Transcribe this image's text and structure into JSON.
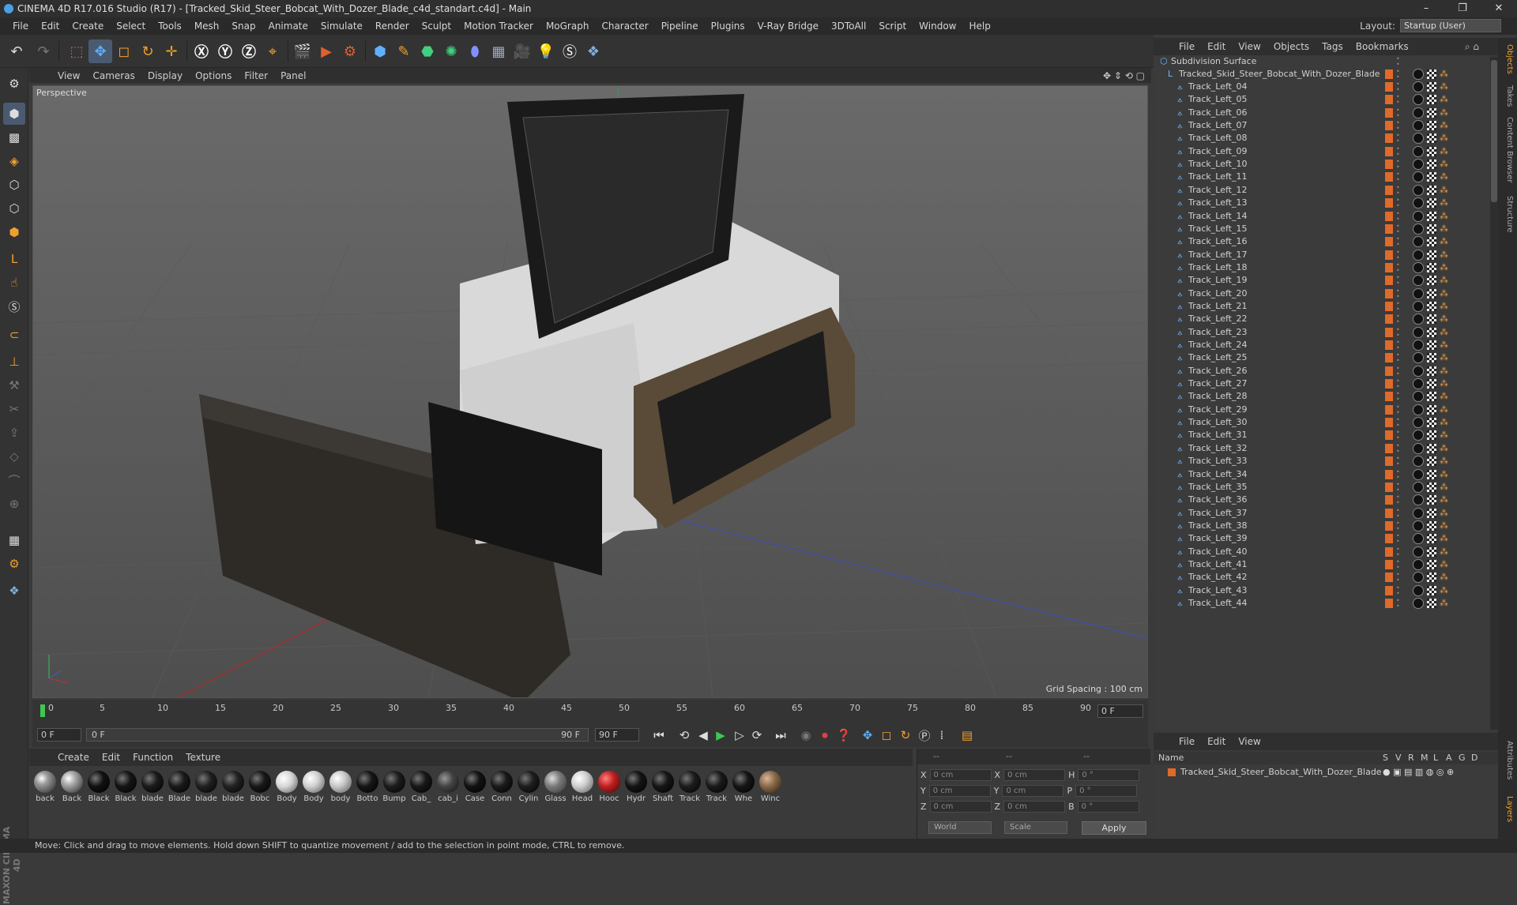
{
  "title": "CINEMA 4D R17.016 Studio (R17) - [Tracked_Skid_Steer_Bobcat_With_Dozer_Blade_c4d_standart.c4d] - Main",
  "window_controls": [
    "–",
    "❐",
    "✕"
  ],
  "menu": [
    "File",
    "Edit",
    "Create",
    "Select",
    "Tools",
    "Mesh",
    "Snap",
    "Animate",
    "Simulate",
    "Render",
    "Sculpt",
    "Motion Tracker",
    "MoGraph",
    "Character",
    "Pipeline",
    "Plugins",
    "V-Ray Bridge",
    "3DToAll",
    "Script",
    "Window",
    "Help"
  ],
  "layout": {
    "label": "Layout:",
    "value": "Startup (User)"
  },
  "viewport": {
    "menu": [
      "View",
      "Cameras",
      "Display",
      "Options",
      "Filter",
      "Panel"
    ],
    "label": "Perspective",
    "grid_spacing": "Grid Spacing : 100 cm"
  },
  "timeline": {
    "ticks": [
      "0",
      "5",
      "10",
      "15",
      "20",
      "25",
      "30",
      "35",
      "40",
      "45",
      "50",
      "55",
      "60",
      "65",
      "70",
      "75",
      "80",
      "85",
      "90"
    ],
    "end_field": "0 F"
  },
  "transport": {
    "current": "0 F",
    "range_start": "0 F",
    "range_end": "90 F",
    "max": "90 F"
  },
  "materials": {
    "menu": [
      "Create",
      "Edit",
      "Function",
      "Texture"
    ],
    "items": [
      {
        "label": "back",
        "color": "#9a9a9a"
      },
      {
        "label": "Back",
        "color": "#b0b0b0"
      },
      {
        "label": "Black",
        "color": "#111111"
      },
      {
        "label": "Black",
        "color": "#151515"
      },
      {
        "label": "blade",
        "color": "#1a1a1a"
      },
      {
        "label": "Blade",
        "color": "#1a1a1a"
      },
      {
        "label": "blade",
        "color": "#202020"
      },
      {
        "label": "blade",
        "color": "#222222"
      },
      {
        "label": "Bobc",
        "color": "#181818"
      },
      {
        "label": "Body",
        "color": "#d8d8d8"
      },
      {
        "label": "Body",
        "color": "#d0d0d0"
      },
      {
        "label": "body",
        "color": "#c8c8c8"
      },
      {
        "label": "Botto",
        "color": "#161616"
      },
      {
        "label": "Bump",
        "color": "#1c1c1c"
      },
      {
        "label": "Cab_",
        "color": "#181818"
      },
      {
        "label": "cab_i",
        "color": "#444444"
      },
      {
        "label": "Case",
        "color": "#121212"
      },
      {
        "label": "Conn",
        "color": "#1a1a1a"
      },
      {
        "label": "Cylin",
        "color": "#1e1e1e"
      },
      {
        "label": "Glass",
        "color": "#7a7a7a"
      },
      {
        "label": "Head",
        "color": "#cfcfcf"
      },
      {
        "label": "Hooc",
        "color": "#c02020"
      },
      {
        "label": "Hydr",
        "color": "#141414"
      },
      {
        "label": "Shaft",
        "color": "#161616"
      },
      {
        "label": "Track",
        "color": "#1c1c1c"
      },
      {
        "label": "Track",
        "color": "#1a1a1a"
      },
      {
        "label": "Whe",
        "color": "#151515"
      },
      {
        "label": "Winc",
        "color": "#8a6a4a"
      }
    ]
  },
  "coords": {
    "header": [
      "--",
      "--",
      "--"
    ],
    "rows": [
      {
        "a": "X",
        "av": "0 cm",
        "b": "X",
        "bv": "0 cm",
        "c": "H",
        "cv": "0 °"
      },
      {
        "a": "Y",
        "av": "0 cm",
        "b": "Y",
        "bv": "0 cm",
        "c": "P",
        "cv": "0 °"
      },
      {
        "a": "Z",
        "av": "0 cm",
        "b": "Z",
        "bv": "0 cm",
        "c": "B",
        "cv": "0 °"
      }
    ],
    "mode1": "World",
    "mode2": "Scale",
    "apply": "Apply"
  },
  "objects": {
    "menu": [
      "File",
      "Edit",
      "View",
      "Objects",
      "Tags",
      "Bookmarks"
    ],
    "root": "Subdivision Surface",
    "parent": "Tracked_Skid_Steer_Bobcat_With_Dozer_Blade",
    "children": [
      "Track_Left_04",
      "Track_Left_05",
      "Track_Left_06",
      "Track_Left_07",
      "Track_Left_08",
      "Track_Left_09",
      "Track_Left_10",
      "Track_Left_11",
      "Track_Left_12",
      "Track_Left_13",
      "Track_Left_14",
      "Track_Left_15",
      "Track_Left_16",
      "Track_Left_17",
      "Track_Left_18",
      "Track_Left_19",
      "Track_Left_20",
      "Track_Left_21",
      "Track_Left_22",
      "Track_Left_23",
      "Track_Left_24",
      "Track_Left_25",
      "Track_Left_26",
      "Track_Left_27",
      "Track_Left_28",
      "Track_Left_29",
      "Track_Left_30",
      "Track_Left_31",
      "Track_Left_32",
      "Track_Left_33",
      "Track_Left_34",
      "Track_Left_35",
      "Track_Left_36",
      "Track_Left_37",
      "Track_Left_38",
      "Track_Left_39",
      "Track_Left_40",
      "Track_Left_41",
      "Track_Left_42",
      "Track_Left_43",
      "Track_Left_44"
    ]
  },
  "side_tabs": [
    "Objects",
    "Takes",
    "Content Browser",
    "Structure",
    "Attributes",
    "Layers"
  ],
  "layers": {
    "menu": [
      "File",
      "Edit",
      "View"
    ],
    "head_name": "Name",
    "head_cols": [
      "S",
      "V",
      "R",
      "M",
      "L",
      "A",
      "G",
      "D"
    ],
    "items": [
      "Tracked_Skid_Steer_Bobcat_With_Dozer_Blade"
    ]
  },
  "status": "Move: Click and drag to move elements. Hold down SHIFT to quantize movement / add to the selection in point mode, CTRL to remove.",
  "brand": "MAXON CINEMA 4D"
}
